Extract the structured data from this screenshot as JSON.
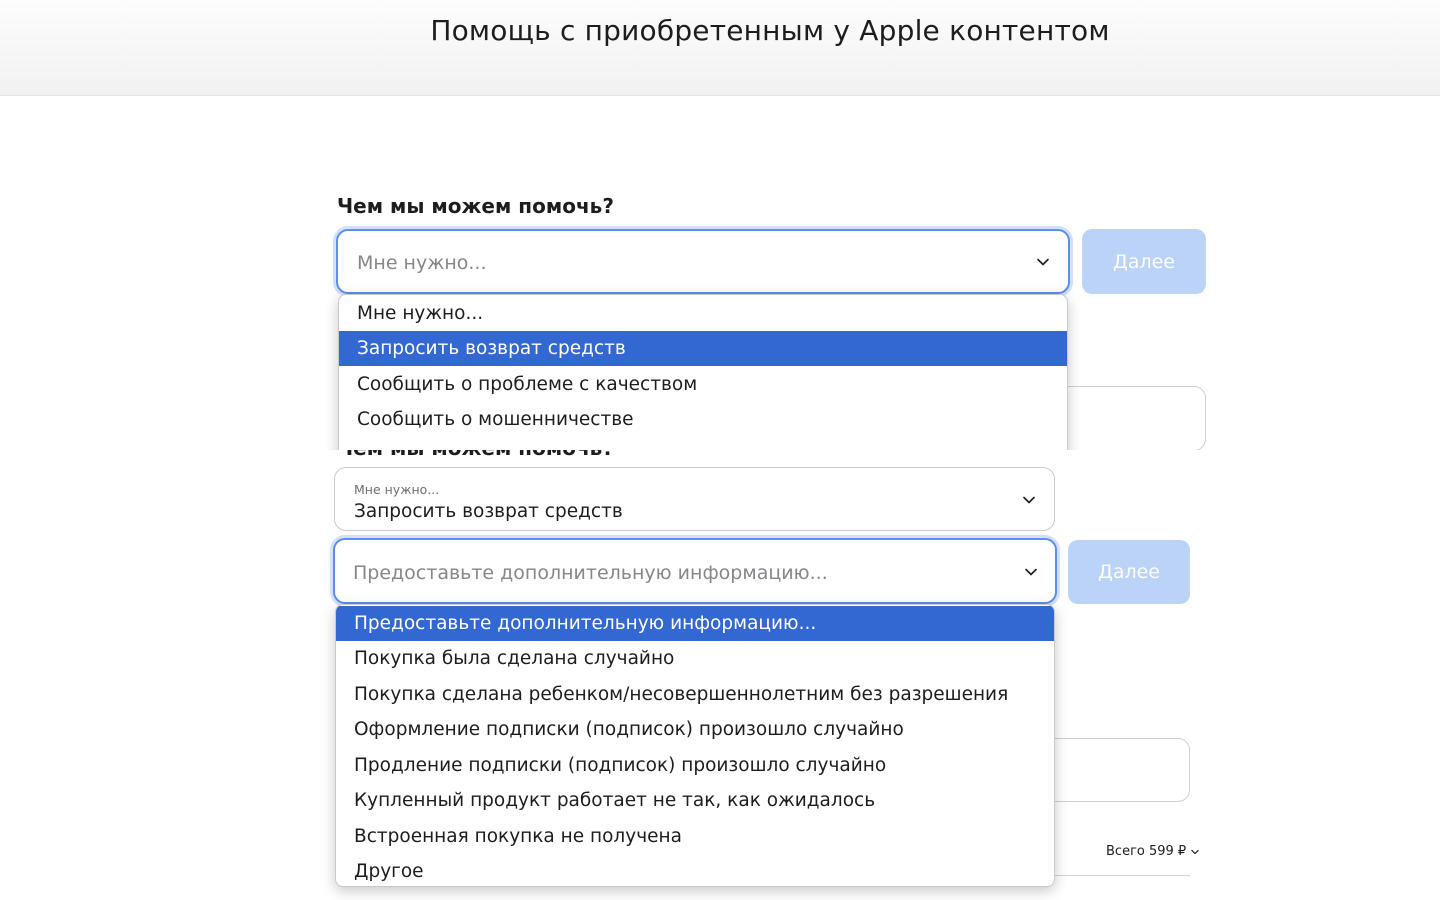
{
  "header": {
    "title": "Помощь с приобретенным у Apple контентом"
  },
  "step1": {
    "label": "Чем мы можем помочь?",
    "placeholder": "Мне нужно...",
    "next_label": "Далее",
    "options": [
      "Мне нужно...",
      "Запросить возврат средств",
      "Сообщить о проблеме с качеством",
      "Сообщить о мошенничестве"
    ],
    "highlighted_option": 1
  },
  "step2": {
    "reason_select": {
      "label": "Мне нужно...",
      "value": "Запросить возврат средств"
    },
    "detail_select": {
      "placeholder": "Предоставьте дополнительную информацию...",
      "next_label": "Далее",
      "options": [
        "Предоставьте дополнительную информацию...",
        "Покупка была сделана случайно",
        "Покупка сделана ребенком/несовершеннолетним без разрешения",
        "Оформление подписки (подписок) произошло случайно",
        "Продление подписки (подписок) произошло случайно",
        "Купленный продукт работает не так, как ожидалось",
        "Встроенная покупка не получена",
        "Другое"
      ],
      "highlighted_option": 0
    },
    "total": "Всего 599 ₽"
  },
  "icons": {
    "chevron": "chevron-down-icon"
  },
  "colors": {
    "accent": "#3367d1",
    "focus_ring": "#5b8ef0",
    "button_disabled": "#bcd3f8"
  }
}
